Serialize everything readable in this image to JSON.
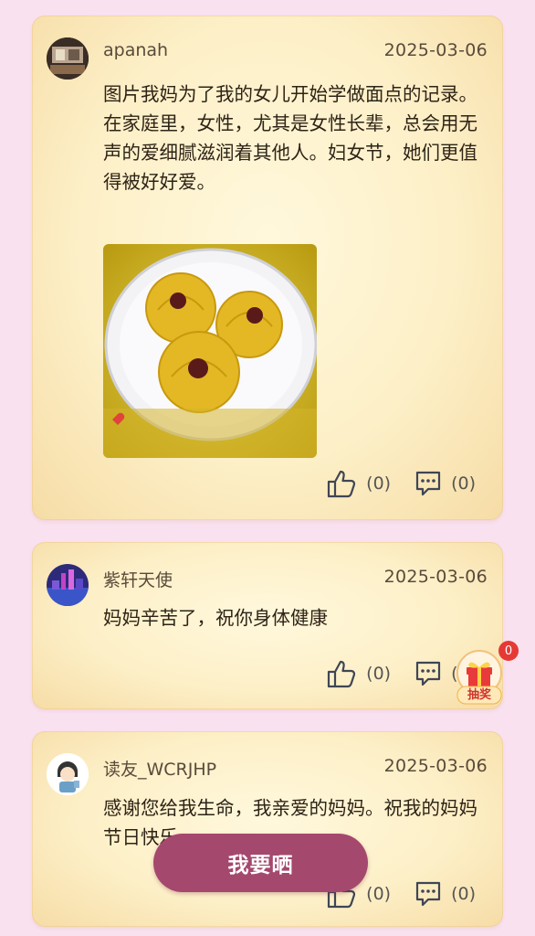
{
  "posts": [
    {
      "username": "apanah",
      "date": "2025-03-06",
      "content": [
        "图片我妈为了我的女儿开始学做面点的记录。",
        "在家庭里，女性，尤其是女性长辈，总会用无声的爱细腻滋润着其他人。妇女节，她们更值得被好好爱。"
      ],
      "likes": "(0)",
      "comments": "(0)"
    },
    {
      "username": "紫轩天使",
      "date": "2025-03-06",
      "content": [
        "妈妈辛苦了，祝你身体健康"
      ],
      "likes": "(0)",
      "comments": "(0)"
    },
    {
      "username": "读友_WCRJHP",
      "date": "2025-03-06",
      "content": [
        "感谢您给我生命，我亲爱的妈妈。祝我的妈妈节日快乐"
      ],
      "likes": "(0)",
      "comments": "(0)"
    }
  ],
  "fab_label": "我要晒",
  "lottery": {
    "label": "抽奖",
    "badge": "0"
  },
  "colors": {
    "page_bg": "#f9e1ef",
    "card_bg": "#fdf0c8",
    "accent": "#a5486e",
    "badge": "#e53935"
  }
}
